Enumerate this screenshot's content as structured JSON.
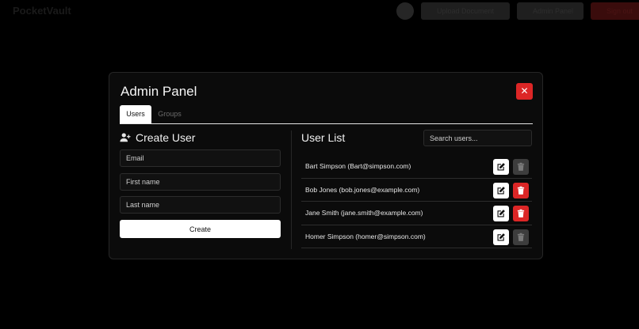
{
  "topbar": {
    "brand": "PocketVault",
    "button_1": "Upload Document",
    "button_2": "Admin Panel",
    "button_3": "Sign out"
  },
  "modal": {
    "title": "Admin Panel",
    "close_label": "✕",
    "tabs": [
      {
        "label": "Users",
        "active": true
      },
      {
        "label": "Groups",
        "active": false
      }
    ]
  },
  "create_user": {
    "title": "Create User",
    "email_placeholder": "Email",
    "first_name_placeholder": "First name",
    "last_name_placeholder": "Last name",
    "create_label": "Create"
  },
  "user_list": {
    "title": "User List",
    "search_placeholder": "Search users...",
    "users": [
      {
        "label": "Bart Simpson (Bart@simpson.com)",
        "delete_enabled": false
      },
      {
        "label": "Bob Jones (bob.jones@example.com)",
        "delete_enabled": true
      },
      {
        "label": "Jane Smith (jane.smith@example.com)",
        "delete_enabled": true
      },
      {
        "label": "Homer Simpson (homer@simpson.com)",
        "delete_enabled": false
      }
    ]
  },
  "colors": {
    "danger": "#dc2626",
    "disabled": "#3d3d3d",
    "background": "#000000",
    "panel": "#0b0b0b"
  },
  "icons": {
    "user_add": "user-plus-icon",
    "edit": "pencil-square-icon",
    "delete": "trash-icon",
    "close": "close-icon"
  }
}
